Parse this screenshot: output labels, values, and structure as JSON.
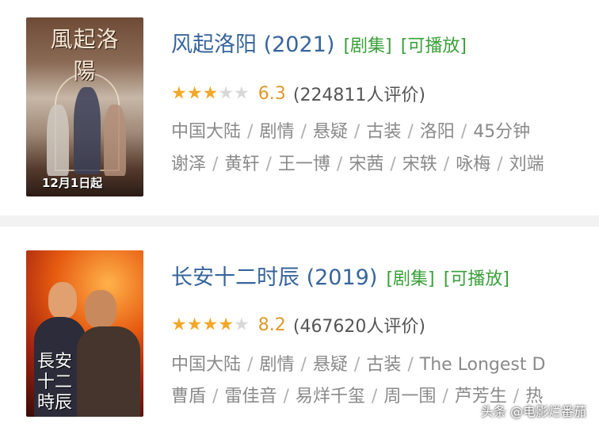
{
  "items": [
    {
      "title": "风起洛阳 (2021)",
      "tags": [
        "[剧集]",
        "[可播放]"
      ],
      "stars_filled": 3,
      "stars_total": 5,
      "score": "6.3",
      "votes": "(224811人评价)",
      "meta": [
        "中国大陆",
        "剧情",
        "悬疑",
        "古装",
        "洛阳",
        "45分钟"
      ],
      "cast": [
        "谢泽",
        "黄轩",
        "王一博",
        "宋茜",
        "宋轶",
        "咏梅",
        "刘端"
      ],
      "poster": {
        "art_title": "風起洛陽",
        "date_text": "12月1日起"
      }
    },
    {
      "title": "长安十二时辰 (2019)",
      "tags": [
        "[剧集]",
        "[可播放]"
      ],
      "stars_filled": 4,
      "stars_total": 5,
      "score": "8.2",
      "votes": "(467620人评价)",
      "meta": [
        "中国大陆",
        "剧情",
        "悬疑",
        "古装",
        "The Longest D"
      ],
      "cast": [
        "曹盾",
        "雷佳音",
        "易烊千玺",
        "周一围",
        "芦芳生",
        "热"
      ],
      "poster": {
        "art_title": "長安十二時辰"
      }
    }
  ],
  "watermark": "头条 @电影烂番茄",
  "colors": {
    "title": "#37659b",
    "tag": "#3aa03a",
    "star": "#f2a82a",
    "score": "#e0982a"
  }
}
